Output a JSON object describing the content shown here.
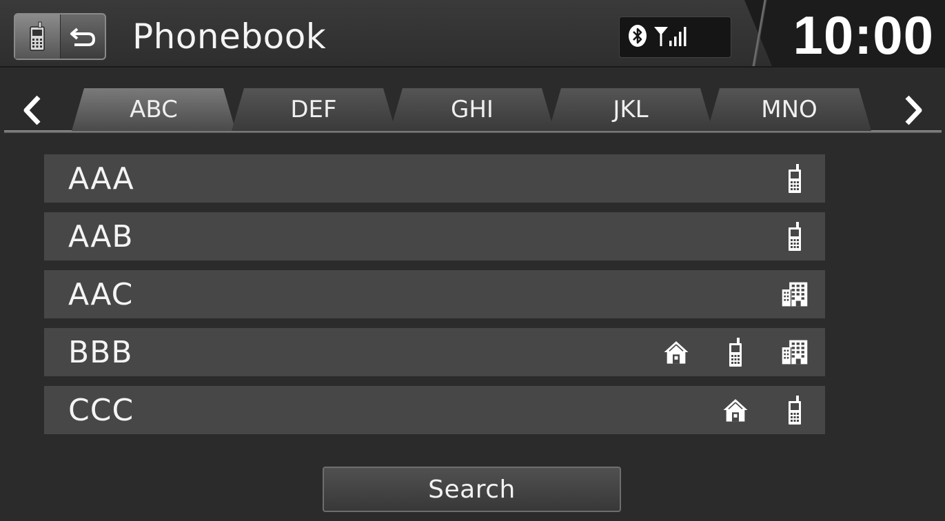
{
  "header": {
    "title": "Phonebook",
    "time": "10:00",
    "icons": {
      "phone": "mobile-phone-icon",
      "back": "back-arrow-icon",
      "bluetooth": "bluetooth-icon",
      "signal": "signal-strength-icon"
    }
  },
  "tabs": [
    {
      "label": "ABC",
      "active": true
    },
    {
      "label": "DEF",
      "active": false
    },
    {
      "label": "GHI",
      "active": false
    },
    {
      "label": "JKL",
      "active": false
    },
    {
      "label": "MNO",
      "active": false
    }
  ],
  "nav": {
    "prev_icon": "chevron-left-icon",
    "next_icon": "chevron-right-icon"
  },
  "contacts": [
    {
      "name": "AAA",
      "numbers": [
        "mobile"
      ]
    },
    {
      "name": "AAB",
      "numbers": [
        "mobile"
      ]
    },
    {
      "name": "AAC",
      "numbers": [
        "work"
      ]
    },
    {
      "name": "BBB",
      "numbers": [
        "home",
        "mobile",
        "work"
      ]
    },
    {
      "name": "CCC",
      "numbers": [
        "home",
        "mobile"
      ]
    }
  ],
  "search": {
    "label": "Search"
  }
}
